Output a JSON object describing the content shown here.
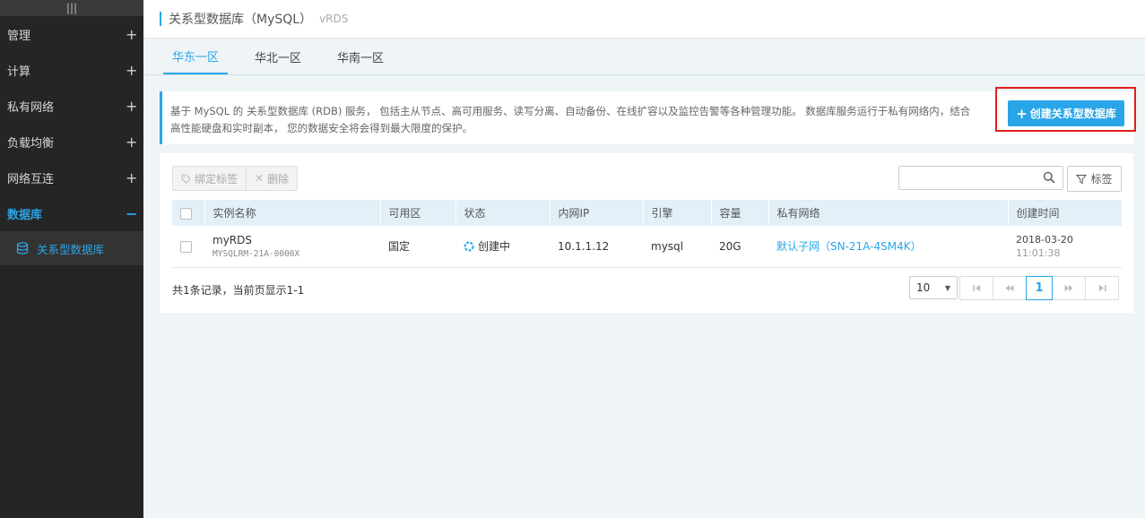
{
  "sidebar": {
    "grip": "|||",
    "items": [
      {
        "label": "管理",
        "sign": "+"
      },
      {
        "label": "计算",
        "sign": "+"
      },
      {
        "label": "私有网络",
        "sign": "+"
      },
      {
        "label": "负载均衡",
        "sign": "+"
      },
      {
        "label": "网络互连",
        "sign": "+"
      },
      {
        "label": "数据库",
        "sign": "−"
      }
    ],
    "sub_item": {
      "label": "关系型数据库",
      "icon": "database-icon"
    }
  },
  "header": {
    "title": "关系型数据库（MySQL）",
    "subtitle": "vRDS"
  },
  "tabs": [
    "华东一区",
    "华北一区",
    "华南一区"
  ],
  "info": {
    "text_line1": "基于 MySQL 的 关系型数据库 (RDB) 服务， 包括主从节点、高可用服务、读写分离、自动备份、在线扩容以及监控告警等各种管理功能。 数据库服务运行于私有网络内，结合",
    "text_line2": "高性能硬盘和实时副本， 您的数据安全将会得到最大限度的保护。",
    "create_button": "创建关系型数据库"
  },
  "toolbar": {
    "bind_tag": "绑定标签",
    "delete": "删除",
    "search_placeholder": "",
    "tag_button": "标签"
  },
  "table": {
    "columns": [
      "实例名称",
      "可用区",
      "状态",
      "内网IP",
      "引擎",
      "容量",
      "私有网络",
      "创建时间"
    ],
    "rows": [
      {
        "name": "myRDS",
        "id": "MYSQLRM-21A-0000X",
        "zone": "国定",
        "status": "创建中",
        "ip": "10.1.1.12",
        "engine": "mysql",
        "capacity": "20G",
        "network": "默认子网（SN-21A-4SM4K）",
        "date": "2018-03-20",
        "time": "11:01:38"
      }
    ]
  },
  "footer": {
    "summary": "共1条记录，当前页显示1-1",
    "page_size": "10",
    "current_page": "1"
  },
  "colors": {
    "accent": "#29a5e8",
    "highlight": "#e0201a",
    "sidebar_bg": "#252525"
  }
}
